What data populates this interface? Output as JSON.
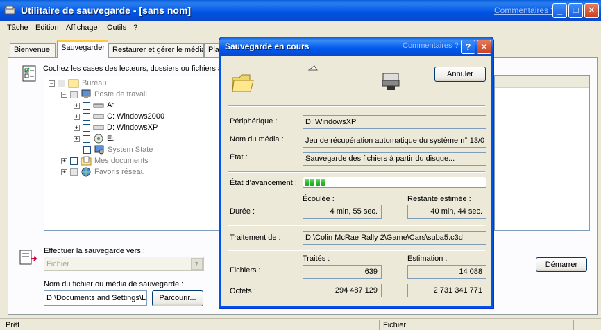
{
  "window": {
    "title": "Utilitaire de sauvegarde - [sans nom]",
    "help_link": "Commentaires ?"
  },
  "menu": [
    "Tâche",
    "Edition",
    "Affichage",
    "Outils",
    "?"
  ],
  "tabs": [
    "Bienvenue !",
    "Sauvegarder",
    "Restaurer et gérer le média",
    "Pla"
  ],
  "instructions": "Cochez les cases des lecteurs, dossiers ou fichiers à s",
  "tree": [
    {
      "label": "Bureau"
    },
    {
      "label": "Poste de travail"
    },
    {
      "label": "A:"
    },
    {
      "label": "C: Windows2000"
    },
    {
      "label": "D: WindowsXP"
    },
    {
      "label": "E:"
    },
    {
      "label": "System State"
    },
    {
      "label": "Mes documents"
    },
    {
      "label": "Favoris réseau"
    }
  ],
  "destination": {
    "label": "Effectuer la sauvegarde vers :",
    "value": "Fichier"
  },
  "media": {
    "label": "Nom du fichier ou média de sauvegarde :",
    "value": "D:\\Documents and Settings\\L",
    "browse": "Parcourir..."
  },
  "start_button": "Démarrer",
  "status_bar": {
    "left": "Prêt",
    "right": "Fichier"
  },
  "dialog": {
    "title": "Sauvegarde en cours",
    "help_link": "Commentaires ?",
    "help_btn": "?",
    "close_btn": "✕",
    "cancel": "Annuler",
    "device_label": "Périphérique :",
    "device": "D: WindowsXP",
    "media_label": "Nom du média :",
    "media": "Jeu de récupération automatique du système n° 13/0",
    "state_label": "État :",
    "state": "Sauvegarde des fichiers à partir du disque...",
    "progress_label": "État d'avancement :",
    "progress_blocks": 4,
    "elapsed_header": "Écoulée :",
    "remaining_header": "Restante estimée :",
    "duration_label": "Durée :",
    "elapsed": "4 min, 55 sec.",
    "remaining": "40 min, 44 sec.",
    "processing_label": "Traitement de :",
    "processing": "D:\\Colin McRae Rally 2\\Game\\Cars\\suba5.c3d",
    "processed_header": "Traités :",
    "estimate_header": "Estimation :",
    "files_label": "Fichiers :",
    "files_processed": "639",
    "files_estimate": "14 088",
    "bytes_label": "Octets :",
    "bytes_processed": "294 487 129",
    "bytes_estimate": "2 731 341 771"
  },
  "colors": {
    "title_blue": "#0054e3",
    "progress_green": "#2dbd2d",
    "dialog_bg": "#ece9d8"
  }
}
